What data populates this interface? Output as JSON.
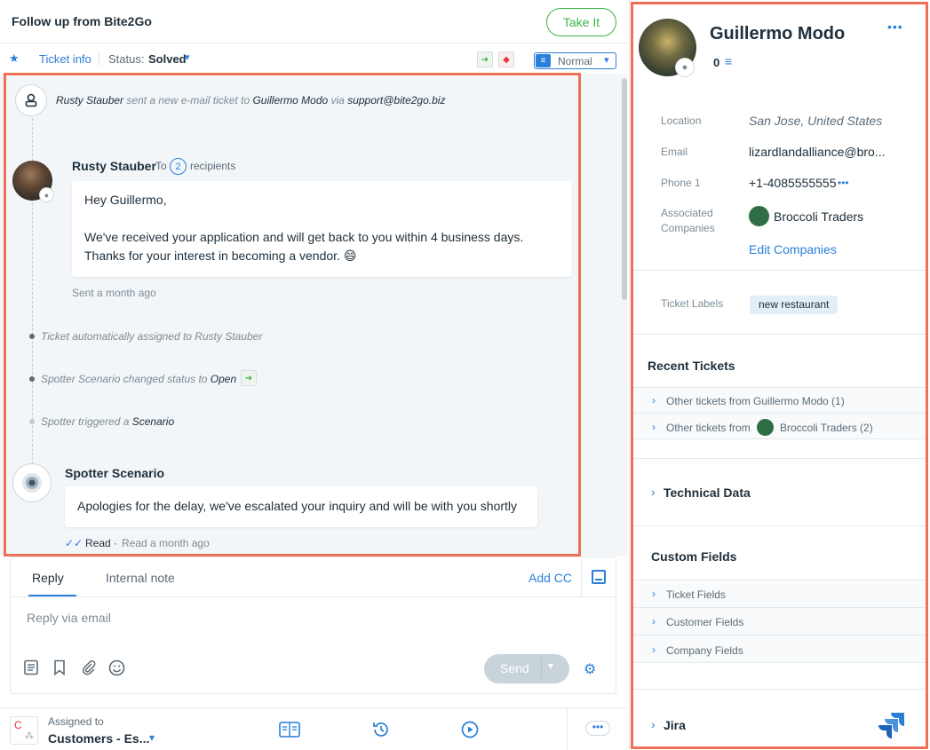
{
  "header": {
    "title": "Follow up from Bite2Go",
    "take_it": "Take It"
  },
  "subbar": {
    "ticket_info": "Ticket info",
    "status_label": "Status:",
    "status_value": "Solved",
    "priority": "Normal"
  },
  "conversation": {
    "system_event": {
      "actor": "Rusty Stauber",
      "middle": "sent a new e-mail ticket to",
      "target": "Guillermo Modo",
      "via": "via",
      "address": "support@bite2go.biz"
    },
    "message1": {
      "sender": "Rusty Stauber",
      "to": "To",
      "recipient_count": "2",
      "recipients": "recipients",
      "line1": "Hey Guillermo,",
      "line2": "We've received your application and will get back to you within 4 business days.",
      "line3": "Thanks for your interest in becoming a vendor. 😄",
      "sent": "Sent a month ago"
    },
    "events": [
      {
        "text": "Ticket automatically assigned to Rusty Stauber"
      },
      {
        "text": "Spotter Scenario changed status to",
        "bold": "Open"
      },
      {
        "text": "Spotter triggered a",
        "bold": "Scenario"
      }
    ],
    "message2": {
      "sender": "Spotter Scenario",
      "body": "Apologies for the delay, we've escalated your inquiry and will be with you shortly",
      "read": "Read",
      "read_time": "Read a month ago"
    }
  },
  "reply": {
    "tab_reply": "Reply",
    "tab_note": "Internal note",
    "add_cc": "Add CC",
    "placeholder": "Reply via email",
    "send": "Send"
  },
  "footer": {
    "assigned_label": "Assigned to",
    "assigned_value": "Customers - Es...",
    "avatar_letter": "C"
  },
  "customer": {
    "name": "Guillermo Modo",
    "count": "0",
    "location_label": "Location",
    "location": "San Jose, United States",
    "email_label": "Email",
    "email": "lizardlandalliance@bro...",
    "phone_label": "Phone 1",
    "phone": "+1-4085555555",
    "companies_label_1": "Associated",
    "companies_label_2": "Companies",
    "company": "Broccoli Traders",
    "edit_companies": "Edit Companies",
    "labels_label": "Ticket Labels",
    "label_chip": "new restaurant"
  },
  "recent": {
    "title": "Recent Tickets",
    "row1": "Other tickets from Guillermo Modo (1)",
    "row2_prefix": "Other tickets from",
    "row2_suffix": "Broccoli Traders (2)"
  },
  "sections": {
    "technical": "Technical Data",
    "custom": "Custom Fields",
    "ticket_fields": "Ticket Fields",
    "customer_fields": "Customer Fields",
    "company_fields": "Company Fields",
    "jira": "Jira"
  },
  "colors": {
    "accent": "#2b7fd9",
    "success": "#3ab54a",
    "highlight": "#f07057"
  }
}
